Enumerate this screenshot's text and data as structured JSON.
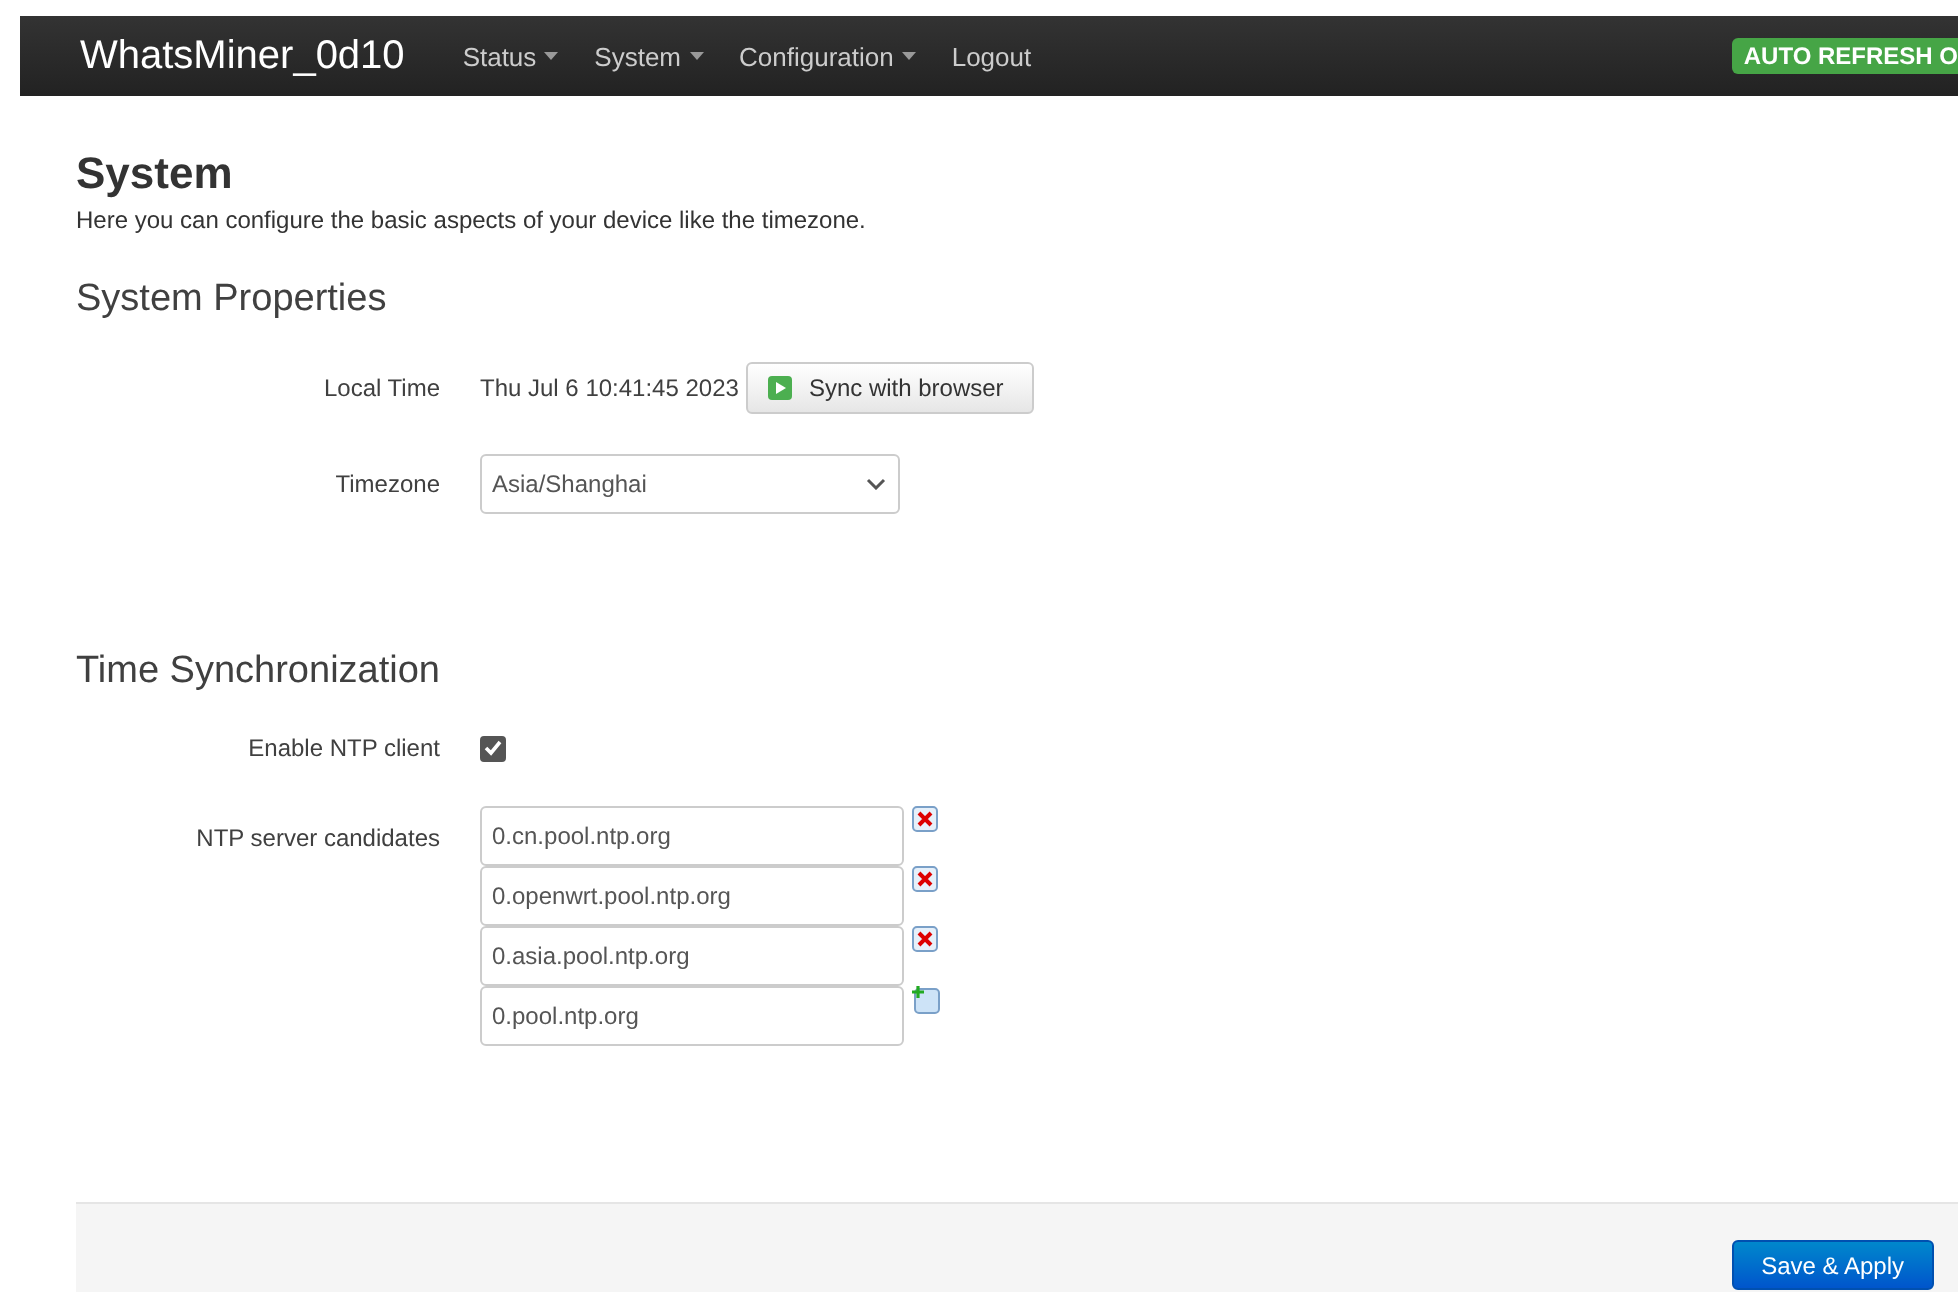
{
  "navbar": {
    "brand": "WhatsMiner_0d10",
    "menu": [
      {
        "label": "Status",
        "dropdown": true
      },
      {
        "label": "System",
        "dropdown": true
      },
      {
        "label": "Configuration",
        "dropdown": true
      },
      {
        "label": "Logout",
        "dropdown": false
      }
    ],
    "badge": "AUTO REFRESH O"
  },
  "page": {
    "title": "System",
    "description": "Here you can configure the basic aspects of your device like the timezone."
  },
  "system_properties": {
    "title": "System Properties",
    "local_time": {
      "label": "Local Time",
      "value": "Thu Jul 6 10:41:45 2023",
      "button": "Sync with browser"
    },
    "timezone": {
      "label": "Timezone",
      "value": "Asia/Shanghai"
    }
  },
  "time_sync": {
    "title": "Time Synchronization",
    "enable_ntp": {
      "label": "Enable NTP client",
      "checked": true
    },
    "servers_label": "NTP server candidates",
    "servers": [
      {
        "value": "0.cn.pool.ntp.org",
        "kind": "remove"
      },
      {
        "value": "0.openwrt.pool.ntp.org",
        "kind": "remove"
      },
      {
        "value": "0.asia.pool.ntp.org",
        "kind": "remove"
      },
      {
        "value": "0.pool.ntp.org",
        "kind": "add"
      }
    ]
  },
  "footer": {
    "button": "Save & Apply"
  }
}
